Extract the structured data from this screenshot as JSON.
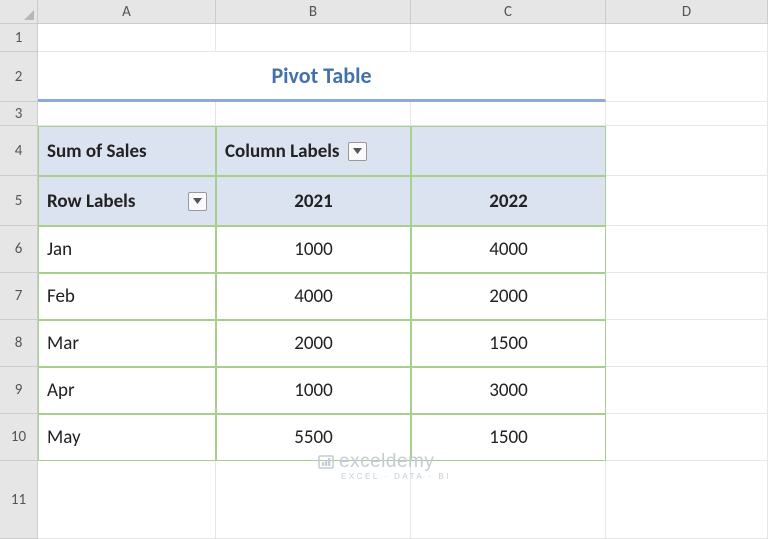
{
  "columns": [
    "A",
    "B",
    "C",
    "D"
  ],
  "rows": [
    "1",
    "2",
    "3",
    "4",
    "5",
    "6",
    "7",
    "8",
    "9",
    "10",
    "11"
  ],
  "title": "Pivot Table",
  "pivot": {
    "sum_label": "Sum of Sales",
    "col_labels": "Column Labels",
    "row_labels": "Row Labels",
    "years": [
      "2021",
      "2022"
    ],
    "data": [
      {
        "month": "Jan",
        "y2021": "1000",
        "y2022": "4000"
      },
      {
        "month": "Feb",
        "y2021": "4000",
        "y2022": "2000"
      },
      {
        "month": "Mar",
        "y2021": "2000",
        "y2022": "1500"
      },
      {
        "month": "Apr",
        "y2021": "1000",
        "y2022": "3000"
      },
      {
        "month": "May",
        "y2021": "5500",
        "y2022": "1500"
      }
    ]
  },
  "watermark": {
    "brand": "exceldemy",
    "tagline": "EXCEL · DATA · BI"
  }
}
